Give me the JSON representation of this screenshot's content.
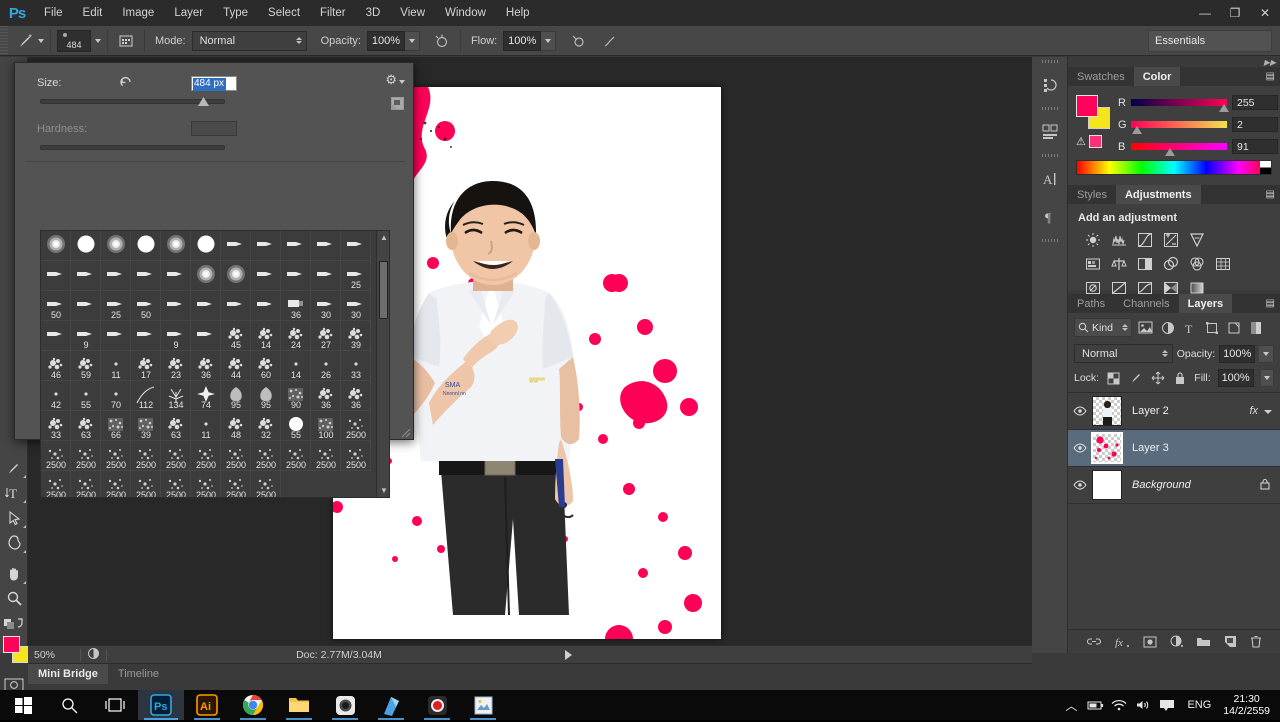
{
  "app": {
    "logo": "Ps",
    "menus": [
      "File",
      "Edit",
      "Image",
      "Layer",
      "Type",
      "Select",
      "Filter",
      "3D",
      "View",
      "Window",
      "Help"
    ],
    "window_buttons": {
      "minimize": "—",
      "maximize": "❐",
      "close": "✕"
    }
  },
  "options_bar": {
    "brush_size_label": "484",
    "mode_label": "Mode:",
    "mode_value": "Normal",
    "opacity_label": "Opacity:",
    "opacity_value": "100%",
    "flow_label": "Flow:",
    "flow_value": "100%",
    "workspace": "Essentials"
  },
  "brush_popup": {
    "size_label": "Size:",
    "size_value": "484 px",
    "hardness_label": "Hardness:",
    "presets": [
      {
        "n": "",
        "k": "soft"
      },
      {
        "n": "",
        "k": "hard"
      },
      {
        "n": "",
        "k": "soft"
      },
      {
        "n": "",
        "k": "hard"
      },
      {
        "n": "",
        "k": "soft"
      },
      {
        "n": "",
        "k": "hard"
      },
      {
        "n": "",
        "k": "flat"
      },
      {
        "n": "",
        "k": "flat"
      },
      {
        "n": "",
        "k": "flat"
      },
      {
        "n": "",
        "k": "flat"
      },
      {
        "n": "",
        "k": "flat"
      },
      {
        "n": "",
        "k": "flat"
      },
      {
        "n": "",
        "k": "flat"
      },
      {
        "n": "",
        "k": "flat"
      },
      {
        "n": "",
        "k": "flat"
      },
      {
        "n": "",
        "k": "flat"
      },
      {
        "n": "",
        "k": "soft"
      },
      {
        "n": "",
        "k": "soft"
      },
      {
        "n": "",
        "k": "flat"
      },
      {
        "n": "",
        "k": "flat"
      },
      {
        "n": "",
        "k": "flat"
      },
      {
        "n": "25",
        "k": "flat"
      },
      {
        "n": "50",
        "k": "flat"
      },
      {
        "n": "",
        "k": "flat"
      },
      {
        "n": "25",
        "k": "flat"
      },
      {
        "n": "50",
        "k": "flat"
      },
      {
        "n": "",
        "k": "flat"
      },
      {
        "n": "",
        "k": "flat"
      },
      {
        "n": "",
        "k": "flat"
      },
      {
        "n": "",
        "k": "flat"
      },
      {
        "n": "36",
        "k": "sq"
      },
      {
        "n": "30",
        "k": "flat"
      },
      {
        "n": "30",
        "k": "flat"
      },
      {
        "n": "",
        "k": "flat"
      },
      {
        "n": "9",
        "k": "flat"
      },
      {
        "n": "",
        "k": "flat"
      },
      {
        "n": "",
        "k": "flat"
      },
      {
        "n": "9",
        "k": "flat"
      },
      {
        "n": "",
        "k": "flat"
      },
      {
        "n": "45",
        "k": "spat"
      },
      {
        "n": "14",
        "k": "spat"
      },
      {
        "n": "24",
        "k": "spat"
      },
      {
        "n": "27",
        "k": "spat"
      },
      {
        "n": "39",
        "k": "spat"
      },
      {
        "n": "46",
        "k": "spat"
      },
      {
        "n": "59",
        "k": "spat"
      },
      {
        "n": "11",
        "k": "dot"
      },
      {
        "n": "17",
        "k": "spat"
      },
      {
        "n": "23",
        "k": "spat"
      },
      {
        "n": "36",
        "k": "spat"
      },
      {
        "n": "44",
        "k": "spat"
      },
      {
        "n": "60",
        "k": "spat"
      },
      {
        "n": "14",
        "k": "dot"
      },
      {
        "n": "26",
        "k": "dot"
      },
      {
        "n": "33",
        "k": "dot"
      },
      {
        "n": "42",
        "k": "dot"
      },
      {
        "n": "55",
        "k": "dot"
      },
      {
        "n": "70",
        "k": "dot"
      },
      {
        "n": "112",
        "k": "curve"
      },
      {
        "n": "134",
        "k": "grass"
      },
      {
        "n": "74",
        "k": "star"
      },
      {
        "n": "95",
        "k": "leaf"
      },
      {
        "n": "95",
        "k": "leaf"
      },
      {
        "n": "90",
        "k": "tex"
      },
      {
        "n": "36",
        "k": "spat"
      },
      {
        "n": "36",
        "k": "spat"
      },
      {
        "n": "33",
        "k": "spat"
      },
      {
        "n": "63",
        "k": "spat"
      },
      {
        "n": "66",
        "k": "tex"
      },
      {
        "n": "39",
        "k": "tex"
      },
      {
        "n": "63",
        "k": "spat"
      },
      {
        "n": "11",
        "k": "dot"
      },
      {
        "n": "48",
        "k": "spat"
      },
      {
        "n": "32",
        "k": "spat"
      },
      {
        "n": "55",
        "k": "circle"
      },
      {
        "n": "100",
        "k": "tex"
      },
      {
        "n": "2500",
        "k": "spark"
      },
      {
        "n": "2500",
        "k": "spark"
      },
      {
        "n": "2500",
        "k": "spark"
      },
      {
        "n": "2500",
        "k": "spark"
      },
      {
        "n": "2500",
        "k": "spark"
      },
      {
        "n": "2500",
        "k": "spark"
      },
      {
        "n": "2500",
        "k": "spark"
      },
      {
        "n": "2500",
        "k": "spark"
      },
      {
        "n": "2500",
        "k": "spark"
      },
      {
        "n": "2500",
        "k": "spark"
      },
      {
        "n": "2500",
        "k": "spark"
      },
      {
        "n": "2500",
        "k": "spark"
      },
      {
        "n": "2500",
        "k": "spark"
      },
      {
        "n": "2500",
        "k": "spark"
      },
      {
        "n": "2500",
        "k": "spark"
      },
      {
        "n": "2500",
        "k": "spark"
      },
      {
        "n": "2500",
        "k": "spark"
      },
      {
        "n": "2500",
        "k": "spark"
      },
      {
        "n": "2500",
        "k": "spark"
      },
      {
        "n": "2500",
        "k": "spark"
      },
      {
        "n": "",
        "k": "none"
      },
      {
        "n": "",
        "k": "none"
      },
      {
        "n": "",
        "k": "none"
      }
    ]
  },
  "tools": [
    {
      "name": "type-tool",
      "glyph": "T"
    },
    {
      "name": "path-selection-tool",
      "glyph": "arrow"
    },
    {
      "name": "shape-tool",
      "glyph": "shape"
    },
    {
      "name": "hand-tool",
      "glyph": "hand"
    },
    {
      "name": "zoom-tool",
      "glyph": "zoom"
    },
    {
      "name": "default-colors",
      "glyph": "swap"
    }
  ],
  "color_swatches": {
    "foreground": "#ff025b",
    "background": "#f5e51e"
  },
  "panels": {
    "color": {
      "tabs": [
        "Color",
        "Swatches"
      ],
      "active_tab": "Color",
      "channels": [
        {
          "letter": "R",
          "value": "255"
        },
        {
          "letter": "G",
          "value": "2"
        },
        {
          "letter": "B",
          "value": "91"
        }
      ]
    },
    "adjustments": {
      "tabs": [
        "Adjustments",
        "Styles"
      ],
      "active_tab": "Adjustments",
      "title": "Add an adjustment",
      "row1": [
        "brightness-contrast-icon",
        "levels-icon",
        "curves-icon",
        "exposure-icon",
        "vibrance-icon"
      ],
      "row2": [
        "hue-saturation-icon",
        "color-balance-icon",
        "black-white-icon",
        "photo-filter-icon",
        "channel-mixer-icon",
        "color-lookup-icon"
      ],
      "row3": [
        "invert-icon",
        "posterize-icon",
        "threshold-icon",
        "selective-color-icon",
        "gradient-map-icon"
      ]
    },
    "layers": {
      "tabs": [
        "Layers",
        "Channels",
        "Paths"
      ],
      "active_tab": "Layers",
      "filter_kind": "Kind",
      "blend_mode": "Normal",
      "opacity_label": "Opacity:",
      "opacity_value": "100%",
      "lock_label": "Lock:",
      "fill_label": "Fill:",
      "fill_value": "100%",
      "rows": [
        {
          "name": "Layer 2",
          "thumb": "person",
          "visible": true,
          "selected": false,
          "fx": "fx",
          "locked": false,
          "italic": false
        },
        {
          "name": "Layer 3",
          "thumb": "splatter",
          "visible": true,
          "selected": true,
          "fx": "",
          "locked": false,
          "italic": false
        },
        {
          "name": "Background",
          "thumb": "white",
          "visible": true,
          "selected": false,
          "fx": "",
          "locked": true,
          "italic": true
        }
      ],
      "footer_icons": [
        "link-icon",
        "fx-icon",
        "mask-icon",
        "adjustment-icon",
        "group-icon",
        "new-layer-icon",
        "delete-icon"
      ]
    }
  },
  "status_bar": {
    "zoom": "50%",
    "doc_info": "Doc: 2.77M/3.04M"
  },
  "bottom_tabs": [
    {
      "label": "Mini Bridge",
      "active": true
    },
    {
      "label": "Timeline",
      "active": false
    }
  ],
  "taskbar": {
    "buttons": [
      {
        "name": "start-button",
        "glyph": "win"
      },
      {
        "name": "search-button",
        "glyph": "search"
      },
      {
        "name": "task-view-button",
        "glyph": "taskview"
      },
      {
        "name": "photoshop-taskbar-button",
        "glyph": "Ps"
      },
      {
        "name": "illustrator-taskbar-button",
        "glyph": "Ai"
      },
      {
        "name": "chrome-taskbar-button",
        "glyph": "chrome"
      },
      {
        "name": "file-explorer-taskbar-button",
        "glyph": "folder"
      },
      {
        "name": "camera-app-taskbar-button",
        "glyph": "camera"
      },
      {
        "name": "notepad-taskbar-button",
        "glyph": "note"
      },
      {
        "name": "recorder-taskbar-button",
        "glyph": "rec"
      },
      {
        "name": "media-taskbar-button",
        "glyph": "media"
      }
    ],
    "tray": {
      "language": "ENG",
      "time": "21:30",
      "date": "14/2/2559"
    }
  }
}
